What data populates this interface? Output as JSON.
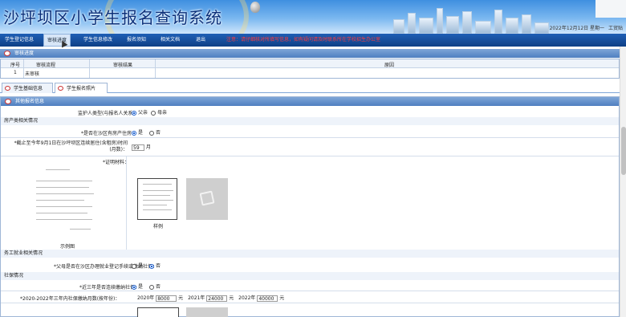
{
  "app": {
    "title": "沙坪坝区小学生报名查询系统",
    "date": "2022年12月12日 星期一",
    "user": "工贸贴"
  },
  "nav": {
    "items": [
      {
        "label": "学生登记信息"
      },
      {
        "label": "审核进度"
      },
      {
        "label": "学生信息修改"
      },
      {
        "label": "报名须知"
      },
      {
        "label": "相关文档"
      },
      {
        "label": "退出"
      }
    ],
    "notice": "注意：请仔细核对所填写信息，如有疑问请及时联系所在学校招生办公室"
  },
  "progress": {
    "section_title": "审核进度",
    "columns": [
      "序号",
      "审核流程",
      "审核结果",
      "原因"
    ],
    "rows": [
      [
        "1",
        "未审核",
        "",
        ""
      ]
    ]
  },
  "tabs": [
    {
      "label": "学生基础信息"
    },
    {
      "label": "学生报名照片"
    }
  ],
  "form": {
    "section_title": "其他报名信息",
    "guardian_q": "监护人类型(与报名人关系)：",
    "guardian_opts": [
      "父亲",
      "母亲"
    ],
    "group1": "房产类相关情况",
    "house_q": "*是否在沙区有房产住房：",
    "yes": "是",
    "no": "否",
    "months_q": "*截止至今年9月1日在沙坪坝区连续居住(含租房)时间(月数)：",
    "months_val": "59",
    "months_unit": "月",
    "proof_label": "*证明材料：",
    "sample_caption": "示例图",
    "doc_caption": "样例",
    "group2": "务工就业相关情况",
    "work_q": "*父母是否在沙区办理就业登记手续或缴纳社保：",
    "group3": "社保情况",
    "ss_q": "*近三年是否连续缴纳社保：",
    "years_q": "*2020-2022年三年内社保缴纳月数(按年份)：",
    "y2020": "2020年",
    "v2020": "8000",
    "y2021": "2021年",
    "v2021": "24000",
    "y2022": "2022年",
    "v2022": "40000",
    "unit": "元"
  }
}
